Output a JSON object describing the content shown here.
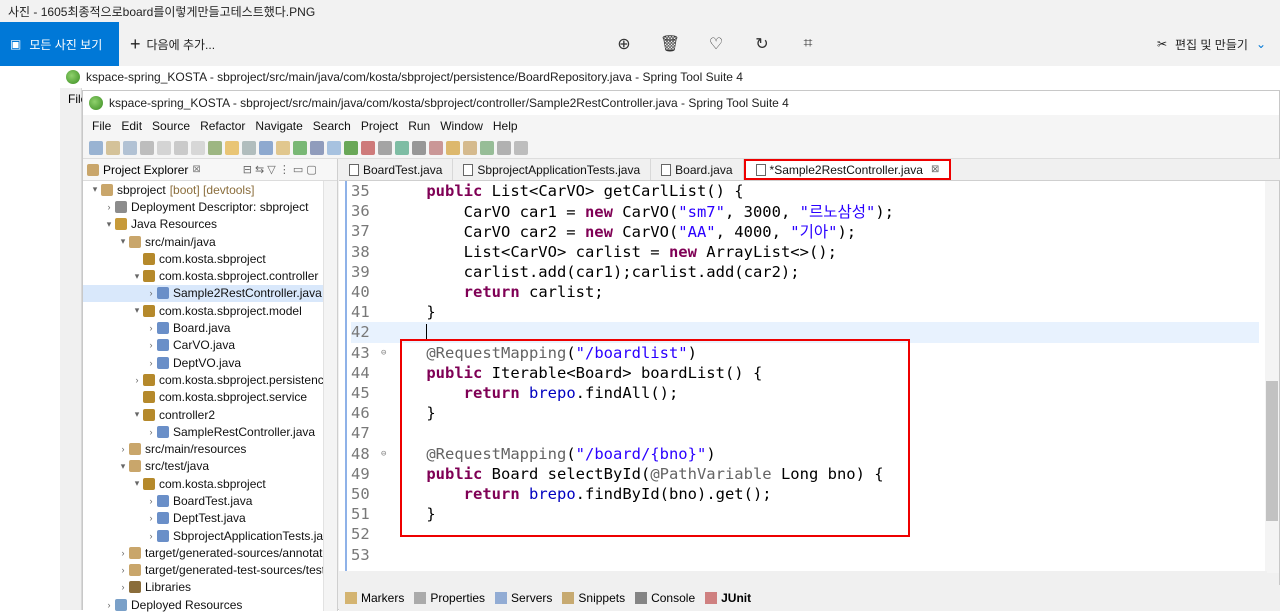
{
  "viewer": {
    "title": "사진 - 1605최종적으로board를이렇게만들고테스트했다.PNG",
    "all_photos": "모든 사진 보기",
    "add_to": "다음에 추가...",
    "edit_create": "편집 및 만들기"
  },
  "back_window": {
    "title": "kspace-spring_KOSTA - sbproject/src/main/java/com/kosta/sbproject/persistence/BoardRepository.java - Spring Tool Suite 4",
    "menu_fragment": "File"
  },
  "window": {
    "title": "kspace-spring_KOSTA - sbproject/src/main/java/com/kosta/sbproject/controller/Sample2RestController.java - Spring Tool Suite 4",
    "menu": [
      "File",
      "Edit",
      "Source",
      "Refactor",
      "Navigate",
      "Search",
      "Project",
      "Run",
      "Window",
      "Help"
    ]
  },
  "explorer": {
    "tab_label": "Project Explorer",
    "items": [
      {
        "label": "sbproject",
        "suffix": "[boot] [devtools]",
        "indent": 0,
        "arrow": "▾"
      },
      {
        "label": "Deployment Descriptor: sbproject",
        "indent": 1,
        "arrow": "›"
      },
      {
        "label": "Java Resources",
        "indent": 1,
        "arrow": "▾"
      },
      {
        "label": "src/main/java",
        "indent": 2,
        "arrow": "▾"
      },
      {
        "label": "com.kosta.sbproject",
        "indent": 3,
        "arrow": ""
      },
      {
        "label": "com.kosta.sbproject.controller",
        "indent": 3,
        "arrow": "▾"
      },
      {
        "label": "Sample2RestController.java",
        "indent": 4,
        "arrow": "›",
        "selected": true
      },
      {
        "label": "com.kosta.sbproject.model",
        "indent": 3,
        "arrow": "▾"
      },
      {
        "label": "Board.java",
        "indent": 4,
        "arrow": "›"
      },
      {
        "label": "CarVO.java",
        "indent": 4,
        "arrow": "›"
      },
      {
        "label": "DeptVO.java",
        "indent": 4,
        "arrow": "›"
      },
      {
        "label": "com.kosta.sbproject.persistence",
        "indent": 3,
        "arrow": "›"
      },
      {
        "label": "com.kosta.sbproject.service",
        "indent": 3,
        "arrow": ""
      },
      {
        "label": "controller2",
        "indent": 3,
        "arrow": "▾"
      },
      {
        "label": "SampleRestController.java",
        "indent": 4,
        "arrow": "›"
      },
      {
        "label": "src/main/resources",
        "indent": 2,
        "arrow": "›"
      },
      {
        "label": "src/test/java",
        "indent": 2,
        "arrow": "▾"
      },
      {
        "label": "com.kosta.sbproject",
        "indent": 3,
        "arrow": "▾"
      },
      {
        "label": "BoardTest.java",
        "indent": 4,
        "arrow": "›"
      },
      {
        "label": "DeptTest.java",
        "indent": 4,
        "arrow": "›"
      },
      {
        "label": "SbprojectApplicationTests.jav",
        "indent": 4,
        "arrow": "›"
      },
      {
        "label": "target/generated-sources/annotati",
        "indent": 2,
        "arrow": "›"
      },
      {
        "label": "target/generated-test-sources/test-",
        "indent": 2,
        "arrow": "›"
      },
      {
        "label": "Libraries",
        "indent": 2,
        "arrow": "›"
      },
      {
        "label": "Deployed Resources",
        "indent": 1,
        "arrow": "›"
      }
    ]
  },
  "editor_tabs": [
    {
      "label": "BoardTest.java",
      "active": false
    },
    {
      "label": "SbprojectApplicationTests.java",
      "active": false
    },
    {
      "label": "Board.java",
      "active": false
    },
    {
      "label": "*Sample2RestController.java",
      "active": true
    }
  ],
  "code_lines": [
    {
      "n": "35",
      "html": "    <span class='kw'>public</span> List&lt;CarVO&gt; getCarlList() {"
    },
    {
      "n": "36",
      "html": "        CarVO car1 = <span class='kw'>new</span> CarVO(<span class='str'>\"sm7\"</span>, 3000, <span class='str'>\"르노삼성\"</span>);"
    },
    {
      "n": "37",
      "html": "        CarVO car2 = <span class='kw'>new</span> CarVO(<span class='str'>\"AA\"</span>, 4000, <span class='str'>\"기아\"</span>);"
    },
    {
      "n": "38",
      "html": "        List&lt;CarVO&gt; carlist = <span class='kw'>new</span> ArrayList&lt;&gt;();"
    },
    {
      "n": "39",
      "html": "        carlist.add(car1);carlist.add(car2);"
    },
    {
      "n": "40",
      "html": "        <span class='kw'>return</span> carlist;"
    },
    {
      "n": "41",
      "html": "    }"
    },
    {
      "n": "42",
      "html": "    ",
      "current": true
    },
    {
      "n": "43",
      "html": "    <span class='ann'>@RequestMapping</span>(<span class='str'>\"/boardlist\"</span>)",
      "fold": true
    },
    {
      "n": "44",
      "html": "    <span class='kw'>public</span> Iterable&lt;Board&gt; boardList() {"
    },
    {
      "n": "45",
      "html": "        <span class='kw'>return</span> <span class='fld'>brepo</span>.findAll();"
    },
    {
      "n": "46",
      "html": "    }"
    },
    {
      "n": "47",
      "html": ""
    },
    {
      "n": "48",
      "html": "    <span class='ann'>@RequestMapping</span>(<span class='str'>\"/board/{bno}\"</span>)",
      "fold": true
    },
    {
      "n": "49",
      "html": "    <span class='kw'>public</span> Board selectById(<span class='ann'>@PathVariable</span> Long bno) {"
    },
    {
      "n": "50",
      "html": "        <span class='kw'>return</span> <span class='fld'>brepo</span>.findById(bno).get();"
    },
    {
      "n": "51",
      "html": "    }"
    },
    {
      "n": "52",
      "html": ""
    },
    {
      "n": "53",
      "html": ""
    }
  ],
  "bottom_tabs": [
    "Markers",
    "Properties",
    "Servers",
    "Snippets",
    "Console",
    "JUnit"
  ]
}
